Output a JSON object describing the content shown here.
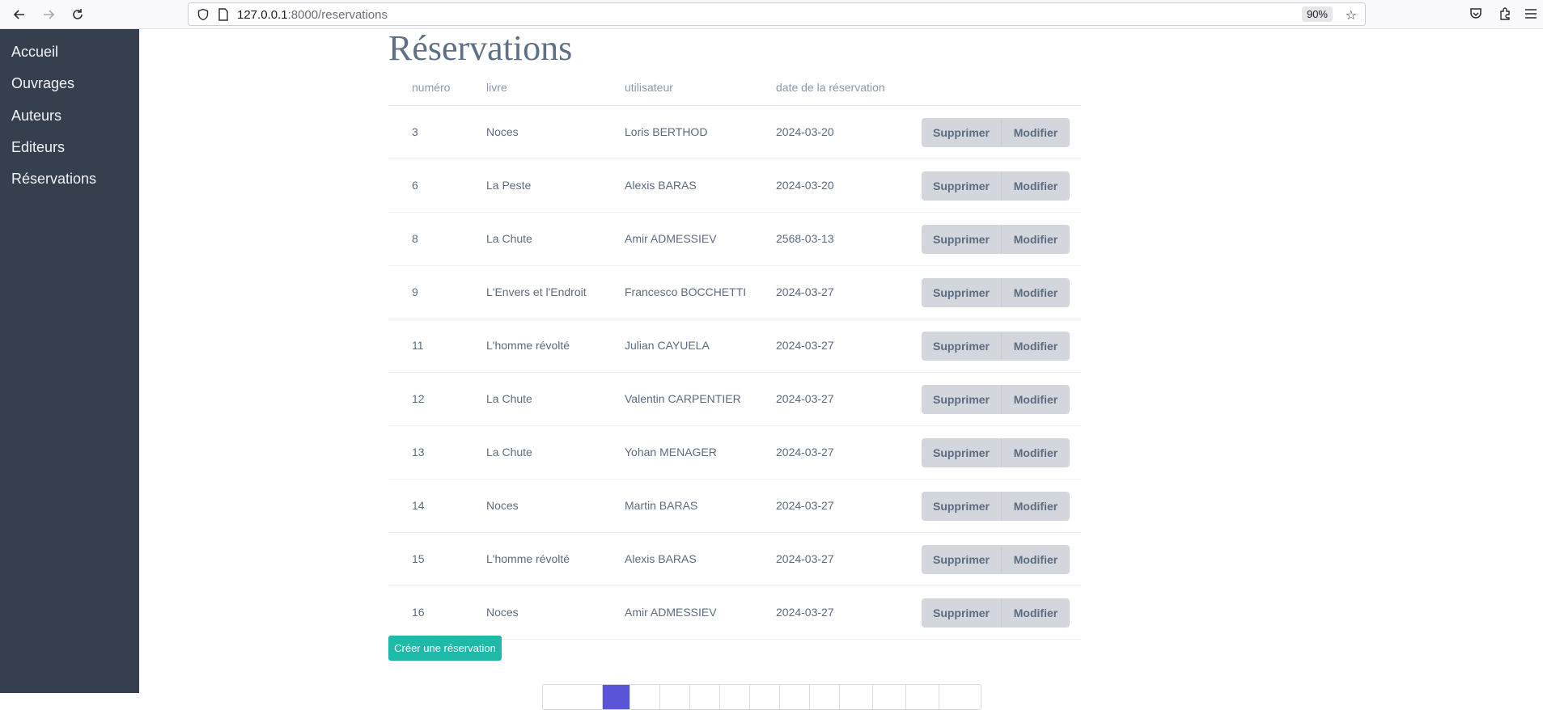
{
  "browser": {
    "url_host": "127.0.0.1",
    "url_rest": ":8000/reservations",
    "zoom": "90%"
  },
  "sidebar": {
    "items": [
      {
        "label": "Accueil"
      },
      {
        "label": "Ouvrages"
      },
      {
        "label": "Auteurs"
      },
      {
        "label": "Editeurs"
      },
      {
        "label": "Réservations"
      }
    ]
  },
  "main": {
    "title": "Réservations",
    "headers": {
      "numero": "numéro",
      "livre": "livre",
      "utilisateur": "utilisateur",
      "date": "date de la réservation"
    },
    "delete_label": "Supprimer",
    "edit_label": "Modifier",
    "rows": [
      {
        "numero": "3",
        "livre": "Noces",
        "utilisateur": "Loris BERTHOD",
        "date": "2024-03-20"
      },
      {
        "numero": "6",
        "livre": "La Peste",
        "utilisateur": "Alexis BARAS",
        "date": "2024-03-20"
      },
      {
        "numero": "8",
        "livre": "La Chute",
        "utilisateur": "Amir ADMESSIEV",
        "date": "2568-03-13"
      },
      {
        "numero": "9",
        "livre": "L'Envers et l'Endroit",
        "utilisateur": "Francesco BOCCHETTI",
        "date": "2024-03-27"
      },
      {
        "numero": "11",
        "livre": "L'homme révolté",
        "utilisateur": "Julian CAYUELA",
        "date": "2024-03-27"
      },
      {
        "numero": "12",
        "livre": "La Chute",
        "utilisateur": "Valentin CARPENTIER",
        "date": "2024-03-27"
      },
      {
        "numero": "13",
        "livre": "La Chute",
        "utilisateur": "Yohan MENAGER",
        "date": "2024-03-27"
      },
      {
        "numero": "14",
        "livre": "Noces",
        "utilisateur": "Martin BARAS",
        "date": "2024-03-27"
      },
      {
        "numero": "15",
        "livre": "L'homme révolté",
        "utilisateur": "Alexis BARAS",
        "date": "2024-03-27"
      },
      {
        "numero": "16",
        "livre": "Noces",
        "utilisateur": "Amir ADMESSIEV",
        "date": "2024-03-27"
      }
    ],
    "create_label": "Créer une réservation"
  },
  "colors": {
    "sidebar_bg": "#363f4d",
    "create_button": "#1fb9a9",
    "pagination_active": "#5a55d6"
  }
}
